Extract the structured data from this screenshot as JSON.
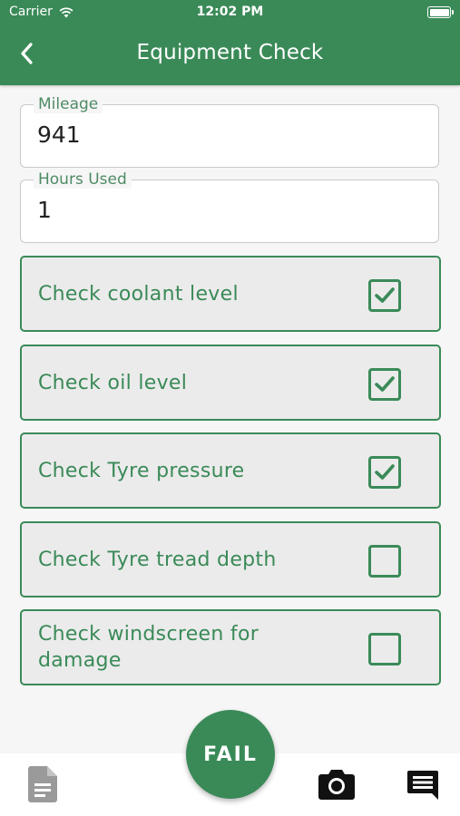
{
  "status_bar": {
    "carrier": "Carrier",
    "time": "12:02 PM"
  },
  "header": {
    "title": "Equipment Check"
  },
  "fields": {
    "mileage": {
      "label": "Mileage",
      "value": "941"
    },
    "hours": {
      "label": "Hours Used",
      "value": "1"
    }
  },
  "checks": [
    {
      "label": "Check coolant level",
      "checked": true
    },
    {
      "label": "Check oil level",
      "checked": true
    },
    {
      "label": "Check Tyre pressure",
      "checked": true
    },
    {
      "label": "Check Tyre tread depth",
      "checked": false
    },
    {
      "label": "Check windscreen for damage",
      "checked": false
    }
  ],
  "actions": {
    "fail_label": "FAIL"
  },
  "icons": {
    "back": "chevron-left-icon",
    "document": "document-icon",
    "camera": "camera-icon",
    "comment": "comment-icon",
    "wifi": "wifi-icon",
    "battery": "battery-icon"
  },
  "colors": {
    "primary": "#3a8a58",
    "item_background": "#ebebeb",
    "page_background": "#f6f6f6"
  }
}
